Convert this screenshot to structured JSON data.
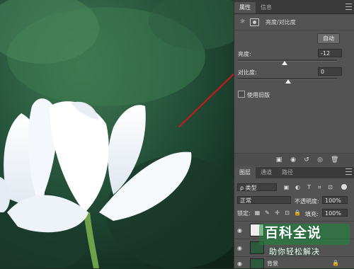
{
  "properties_panel": {
    "tabs": [
      {
        "label": "属性"
      },
      {
        "label": "信息"
      }
    ],
    "adjustment_title": "亮度/对比度",
    "auto_button": "自动",
    "brightness": {
      "label": "亮度:",
      "value": "-12"
    },
    "contrast": {
      "label": "对比度:",
      "value": "0"
    },
    "use_legacy": {
      "label": "使用旧版",
      "checked": false
    }
  },
  "layers_panel": {
    "tabs": [
      {
        "label": "图层"
      },
      {
        "label": "通道"
      },
      {
        "label": "路径"
      }
    ],
    "filter_kind": "ρ 类型",
    "blend_mode": "正常",
    "opacity": {
      "label": "不透明度:",
      "value": "100%"
    },
    "lock_label": "锁定:",
    "fill": {
      "label": "填充:",
      "value": "100%"
    },
    "layers": [
      {
        "name": "",
        "type": "adjustment"
      },
      {
        "name": "",
        "type": "image"
      },
      {
        "name": "背景",
        "type": "background"
      }
    ]
  },
  "watermark": {
    "title": "百科全说",
    "subtitle": "助你轻松解决"
  },
  "colors": {
    "panel_bg": "#535353",
    "tab_bg": "#3a3a3a",
    "arrow": "#d01818",
    "watermark_green": "#1a8a3a"
  }
}
